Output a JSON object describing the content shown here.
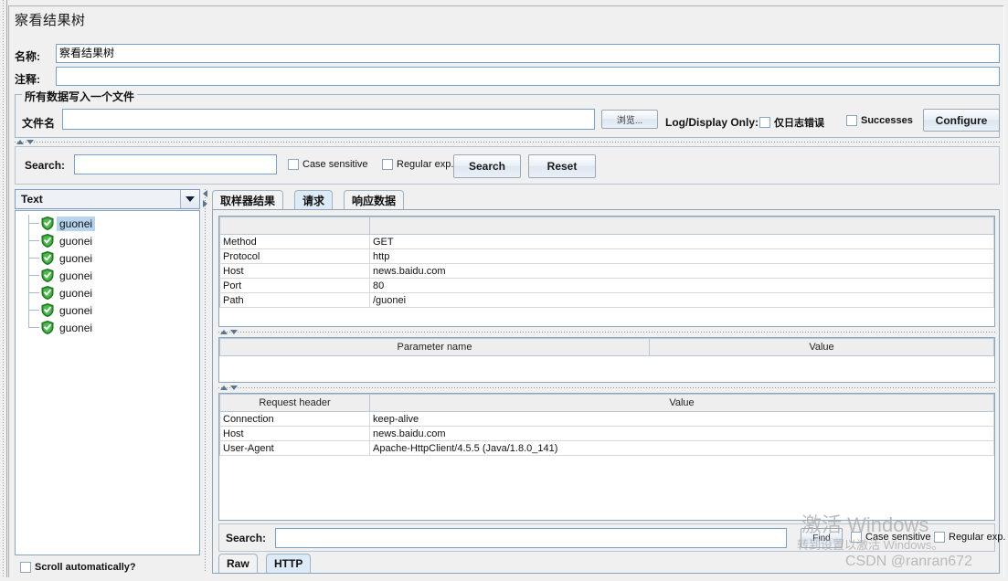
{
  "window": {
    "title": "察看结果树"
  },
  "form": {
    "name_label": "名称:",
    "name_value": "察看结果树",
    "comment_label": "注释:",
    "comment_value": ""
  },
  "file_group": {
    "title": "所有数据写入一个文件",
    "filename_label": "文件名",
    "filename_value": "",
    "browse_button": "浏览...",
    "log_display_label": "Log/Display Only:",
    "errors_checkbox": "仅日志错误",
    "errors_checked": false,
    "successes_checkbox": "Successes",
    "successes_checked": false,
    "configure_button": "Configure"
  },
  "search_bar": {
    "label": "Search:",
    "value": "",
    "case_sensitive_label": "Case sensitive",
    "case_sensitive_checked": false,
    "regular_exp_label": "Regular exp.",
    "regular_exp_checked": false,
    "search_button": "Search",
    "reset_button": "Reset"
  },
  "left_panel": {
    "renderer_selected": "Text",
    "tree_items": [
      {
        "label": "guonei",
        "selected": true
      },
      {
        "label": "guonei",
        "selected": false
      },
      {
        "label": "guonei",
        "selected": false
      },
      {
        "label": "guonei",
        "selected": false
      },
      {
        "label": "guonei",
        "selected": false
      },
      {
        "label": "guonei",
        "selected": false
      },
      {
        "label": "guonei",
        "selected": false
      }
    ],
    "scroll_auto_label": "Scroll automatically?",
    "scroll_auto_checked": false
  },
  "right_panel": {
    "tabs": [
      {
        "label": "取样器结果",
        "active": false
      },
      {
        "label": "请求",
        "active": true
      },
      {
        "label": "响应数据",
        "active": false
      }
    ],
    "request_table": {
      "header": [
        "",
        ""
      ],
      "rows": [
        [
          "Method",
          "GET"
        ],
        [
          "Protocol",
          "http"
        ],
        [
          "Host",
          "news.baidu.com"
        ],
        [
          "Port",
          "80"
        ],
        [
          "Path",
          "/guonei"
        ]
      ]
    },
    "parameter_table": {
      "header": [
        "Parameter name",
        "Value"
      ],
      "rows": []
    },
    "request_header_table": {
      "header": [
        "Request header",
        "Value"
      ],
      "rows": [
        [
          "Connection",
          "keep-alive"
        ],
        [
          "Host",
          "news.baidu.com"
        ],
        [
          "User-Agent",
          "Apache-HttpClient/4.5.5 (Java/1.8.0_141)"
        ]
      ]
    },
    "bottom_search": {
      "label": "Search:",
      "value": "",
      "find_button": "Find",
      "case_sensitive_label": "Case sensitive",
      "case_sensitive_checked": false,
      "regular_exp_label": "Regular exp.",
      "regular_exp_checked": false
    },
    "view_tabs": [
      {
        "label": "Raw",
        "active": false
      },
      {
        "label": "HTTP",
        "active": true
      }
    ]
  },
  "watermarks": {
    "activate_line1": "激活 Windows",
    "activate_line2": "转到设置以激活 Windows。",
    "csdn": "CSDN @ranran672"
  }
}
